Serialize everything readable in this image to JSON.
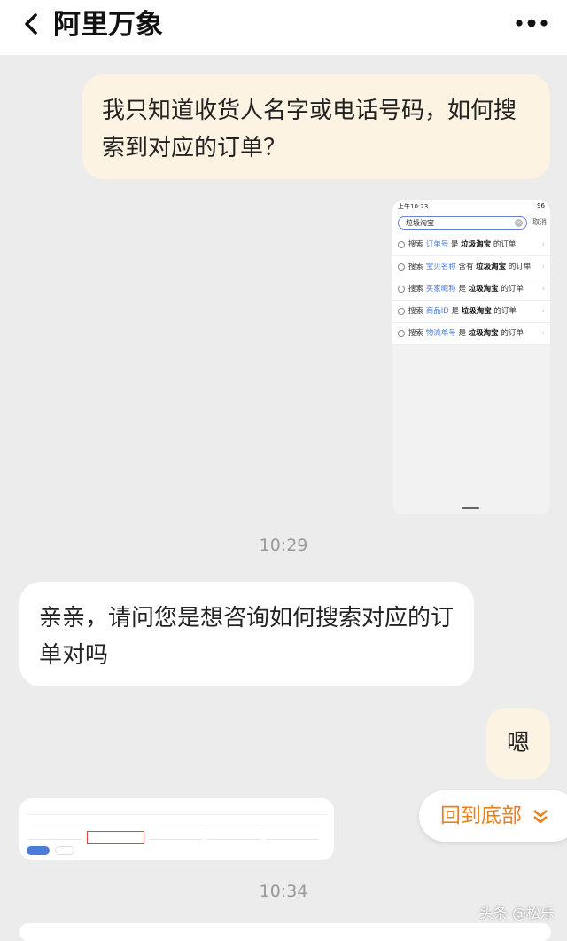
{
  "header": {
    "title": "阿里万象",
    "back_icon": "chevron-left-icon",
    "more_icon": "more-dots-icon"
  },
  "messages": {
    "user_question": "我只知道收货人名字或电话号码，如何搜索到对应的订单？",
    "time_1": "10:29",
    "bot_reply": "亲亲，请问您是想咨询如何搜索对应的订单对吗",
    "user_confirm": "嗯",
    "time_2": "10:34"
  },
  "phone_screenshot": {
    "status_time": "上午10:23",
    "status_right": "96",
    "search_query": "垃圾淘宝",
    "cancel_label": "取消",
    "suggestions": [
      {
        "prefix": "搜索",
        "field": "订单号",
        "rel": "是",
        "term": "垃圾淘宝",
        "suffix": "的订单"
      },
      {
        "prefix": "搜索",
        "field": "宝贝名称",
        "rel": "含有",
        "term": "垃圾淘宝",
        "suffix": "的订单"
      },
      {
        "prefix": "搜索",
        "field": "买家昵称",
        "rel": "是",
        "term": "垃圾淘宝",
        "suffix": "的订单"
      },
      {
        "prefix": "搜索",
        "field": "商品ID",
        "rel": "是",
        "term": "垃圾淘宝",
        "suffix": "的订单"
      },
      {
        "prefix": "搜索",
        "field": "物流单号",
        "rel": "是",
        "term": "垃圾淘宝",
        "suffix": "的订单"
      }
    ]
  },
  "floating": {
    "back_to_bottom": "回到底部"
  },
  "watermark": "头条 @松乐",
  "colors": {
    "user_bubble": "#fdf3e2",
    "accent_orange": "#e8821e",
    "link_blue": "#4a7bd8"
  }
}
